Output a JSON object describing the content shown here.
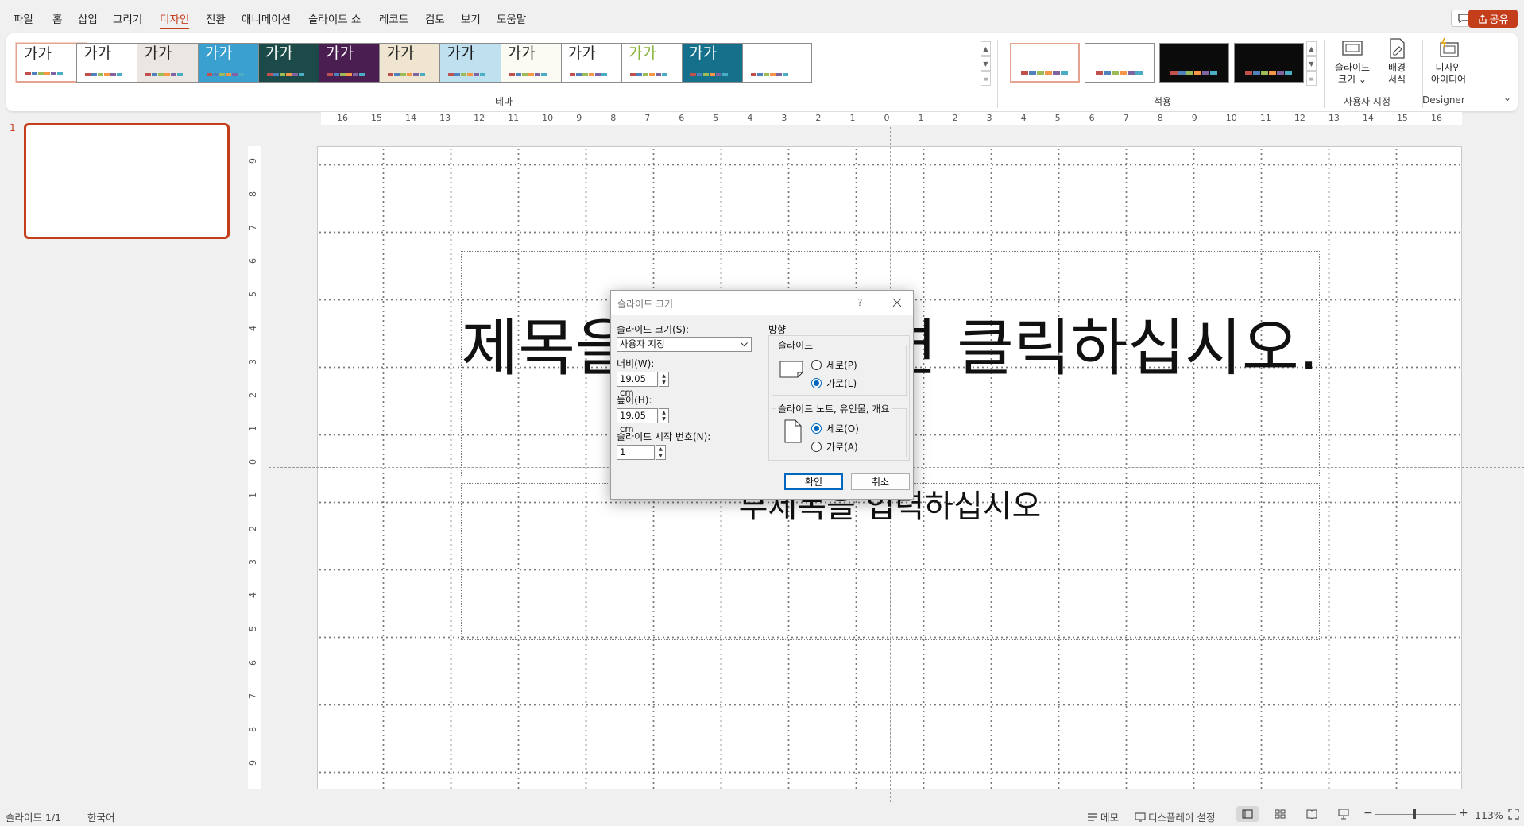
{
  "menu": {
    "items": [
      "파일",
      "홈",
      "삽입",
      "그리기",
      "디자인",
      "전환",
      "애니메이션",
      "슬라이드 쇼",
      "레코드",
      "검토",
      "보기",
      "도움말"
    ],
    "active_index": 4,
    "share_label": "공유"
  },
  "ribbon": {
    "themes": [
      {
        "text": "가가",
        "bg": "#ffffff",
        "fg": "#262626",
        "selected": true
      },
      {
        "text": "가가",
        "bg": "#ffffff",
        "fg": "#262626"
      },
      {
        "text": "가가",
        "bg": "#ece6e2",
        "fg": "#262626"
      },
      {
        "text": "가가",
        "bg": "#3aa0cf",
        "fg": "#ffffff"
      },
      {
        "text": "가가",
        "bg": "#1b4a48",
        "fg": "#ffffff"
      },
      {
        "text": "가가",
        "bg": "#4b1e52",
        "fg": "#ffffff"
      },
      {
        "text": "가가",
        "bg": "#efe5d0",
        "fg": "#262626"
      },
      {
        "text": "가가",
        "bg": "#bfe0ee",
        "fg": "#1a1a1a"
      },
      {
        "text": "가가",
        "bg": "#fbfbf4",
        "fg": "#262626"
      },
      {
        "text": "가가",
        "bg": "#ffffff",
        "fg": "#262626"
      },
      {
        "text": "가가",
        "bg": "#ffffff",
        "fg": "#8ab43c"
      },
      {
        "text": "가가",
        "bg": "#15708c",
        "fg": "#ffffff"
      },
      {
        "text": "",
        "bg": "#ffffff",
        "fg": "#262626"
      }
    ],
    "theme_group_label": "테마",
    "variants_group_label": "적용",
    "customize": {
      "slide_size_label": "슬라이드\n크기 ⌄",
      "bg_format_label": "배경\n서식",
      "group_label": "사용자 지정"
    },
    "designer": {
      "label": "디자인\n아이디어",
      "group_label": "Designer"
    }
  },
  "slide_panel": {
    "number": "1"
  },
  "ruler": {
    "h_labels": [
      "16",
      "15",
      "14",
      "13",
      "12",
      "11",
      "10",
      "9",
      "8",
      "7",
      "6",
      "5",
      "4",
      "3",
      "2",
      "1",
      "0",
      "1",
      "2",
      "3",
      "4",
      "5",
      "6",
      "7",
      "8",
      "9",
      "10",
      "11",
      "12",
      "13",
      "14",
      "15",
      "16"
    ],
    "v_labels": [
      "9",
      "8",
      "7",
      "6",
      "5",
      "4",
      "3",
      "2",
      "1",
      "0",
      "1",
      "2",
      "3",
      "4",
      "5",
      "6",
      "7",
      "8",
      "9"
    ]
  },
  "slide": {
    "title": "제목을 추가하려면 클릭하십시오.",
    "subtitle": "부제목을 입력하십시오"
  },
  "dialog": {
    "title": "슬라이드 크기",
    "help": "?",
    "size_label": "슬라이드 크기(S):",
    "size_value": "사용자 지정",
    "width_label": "너비(W):",
    "width_value": "19.05 cm",
    "height_label": "높이(H):",
    "height_value": "19.05 cm",
    "start_label": "슬라이드 시작 번호(N):",
    "start_value": "1",
    "orientation_label": "방향",
    "slides_group": "슬라이드",
    "slides_portrait": "세로(P)",
    "slides_landscape": "가로(L)",
    "slides_selected": "landscape",
    "notes_group": "슬라이드 노트, 유인물, 개요",
    "notes_portrait": "세로(O)",
    "notes_landscape": "가로(A)",
    "notes_selected": "portrait",
    "ok": "확인",
    "cancel": "취소"
  },
  "status": {
    "slide": "슬라이드 1/1",
    "language": "한국어",
    "notes": "메모",
    "display": "디스플레이 설정",
    "zoom": "113%"
  },
  "colors": {
    "accent": "#c43e1c",
    "dialog_accent": "#0067c0"
  }
}
